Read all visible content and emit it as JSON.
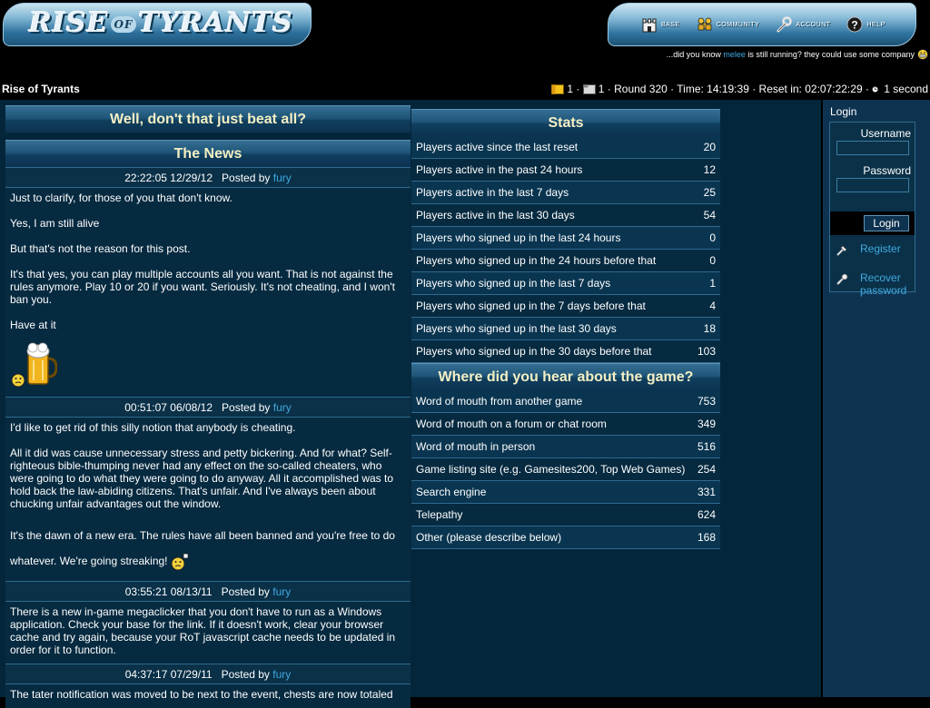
{
  "header": {
    "logo_text_left": "RISE",
    "logo_text_of": "OF",
    "logo_text_right": "TYRANTS",
    "nav": [
      {
        "label": "Base",
        "icon": "castle-icon"
      },
      {
        "label": "Community",
        "icon": "community-icon"
      },
      {
        "label": "Account",
        "icon": "wrench-icon"
      },
      {
        "label": "Help",
        "icon": "help-icon"
      }
    ],
    "did_you_know_prefix": "...did you know",
    "did_you_know_link": "melee",
    "did_you_know_suffix": "is still running? they could use some company"
  },
  "infobar": {
    "site_title": "Rise of Tyrants",
    "count_a": "1 ·",
    "count_b": "1 · Round 320 · Time: 14:19:39 · Reset in: 02:07:22:29 ·",
    "refresh": "1 second"
  },
  "left": {
    "banner": "Well, don't that just beat all?",
    "news_title": "The News",
    "posts": [
      {
        "stamp": "22:22:05 12/29/12",
        "posted_by": "Posted by",
        "author": "fury",
        "paragraphs": [
          "Just to clarify, for those of you that don't know.",
          "Yes, I am still alive",
          "But that's not the reason for this post.",
          "It's that yes, you can play multiple accounts all you want. That is not against the rules anymore. Play 10 or 20 if you want. Seriously. It's not cheating, and I won't ban you.",
          "Have at it"
        ]
      },
      {
        "stamp": "00:51:07 06/08/12",
        "posted_by": "Posted by",
        "author": "fury",
        "paragraphs": [
          "I'd like to get rid of this silly notion that anybody is cheating.",
          "All it did was cause unnecessary stress and petty bickering. And for what? Self-righteous bible-thumping never had any effect on the so-called cheaters, who were going to do what they were going to do anyway. All it accomplished was to hold back the law-abiding citizens. That's unfair. And I've always been about chucking unfair advantages out the window.",
          "It's the dawn of a new era. The rules have all been banned and you're free to do whatever. We're going streaking!"
        ]
      },
      {
        "stamp": "03:55:21 08/13/11",
        "posted_by": "Posted by",
        "author": "fury",
        "paragraphs": [
          "There is a new in-game megaclicker that you don't have to run as a Windows application. Check your base for the link. If it doesn't work, clear your browser cache and try again, because your RoT javascript cache needs to be updated in order for it to function."
        ]
      },
      {
        "stamp": "04:37:17 07/29/11",
        "posted_by": "Posted by",
        "author": "fury",
        "paragraphs": [
          "The tater notification was moved to be next to the event, chests are now totaled"
        ]
      }
    ]
  },
  "stats": {
    "title": "Stats",
    "rows": [
      {
        "label": "Players active since the last reset",
        "value": "20"
      },
      {
        "label": "Players active in the past 24 hours",
        "value": "12"
      },
      {
        "label": "Players active in the last 7 days",
        "value": "25"
      },
      {
        "label": "Players active in the last 30 days",
        "value": "54"
      },
      {
        "label": "Players who signed up in the last 24 hours",
        "value": "0"
      },
      {
        "label": "Players who signed up in the 24 hours before that",
        "value": "0"
      },
      {
        "label": "Players who signed up in the last 7 days",
        "value": "1"
      },
      {
        "label": "Players who signed up in the 7 days before that",
        "value": "4"
      },
      {
        "label": "Players who signed up in the last 30 days",
        "value": "18"
      },
      {
        "label": "Players who signed up in the 30 days before that",
        "value": "103"
      }
    ]
  },
  "hear": {
    "title": "Where did you hear about the game?",
    "rows": [
      {
        "label": "Word of mouth from another game",
        "value": "753"
      },
      {
        "label": "Word of mouth on a forum or chat room",
        "value": "349"
      },
      {
        "label": "Word of mouth in person",
        "value": "516"
      },
      {
        "label": "Game listing site (e.g. Gamesites200, Top Web Games)",
        "value": "254"
      },
      {
        "label": "Search engine",
        "value": "331"
      },
      {
        "label": "Telepathy",
        "value": "624"
      },
      {
        "label": "Other (please describe below)",
        "value": "168"
      }
    ]
  },
  "login": {
    "title": "Login",
    "username_label": "Username",
    "password_label": "Password",
    "username_value": "",
    "password_value": "",
    "button": "Login",
    "register": "Register",
    "recover": "Recover password"
  }
}
